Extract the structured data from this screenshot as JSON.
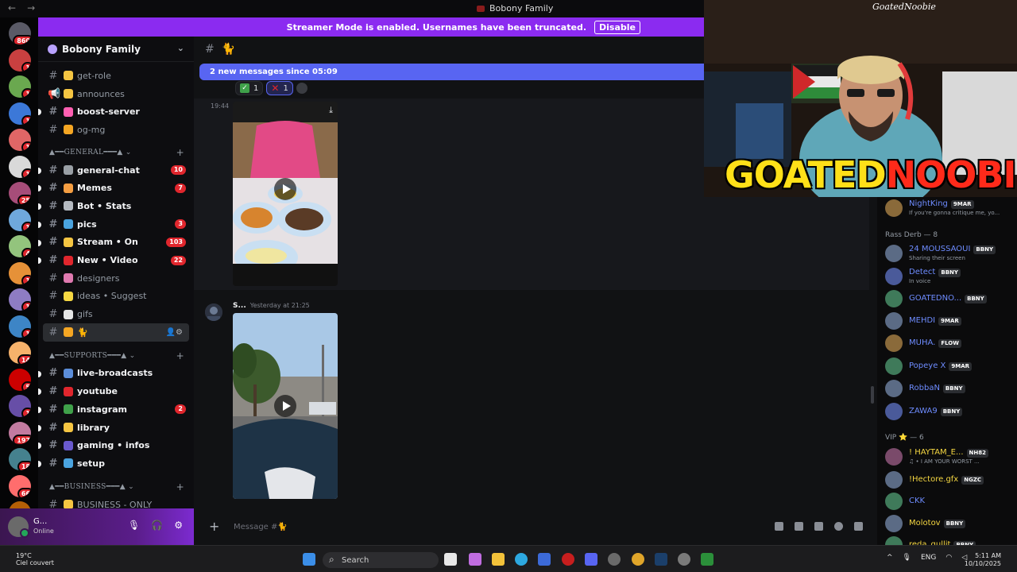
{
  "window": {
    "title": "Bobony Family"
  },
  "banner": {
    "text": "Streamer Mode is enabled. Usernames have been truncated.",
    "button": "Disable"
  },
  "guild": {
    "name": "Bobony Family"
  },
  "channels": [
    {
      "label": "get-role",
      "emoji_color": "#f5c542",
      "unread": false
    },
    {
      "label": "announces",
      "emoji_color": "#f5c542",
      "unread": false,
      "icon": "megaphone"
    },
    {
      "label": "boost-server",
      "emoji_color": "#ff5fb2",
      "unread": true
    },
    {
      "label": "og-mg",
      "emoji_color": "#f5a623",
      "unread": false
    }
  ],
  "general": {
    "title": "GENERAL",
    "channels": [
      {
        "label": "general-chat",
        "emoji_color": "#9aa0a6",
        "unread": true,
        "count": "10"
      },
      {
        "label": "Memes",
        "emoji_color": "#f59e42",
        "unread": true,
        "count": "7"
      },
      {
        "label": "Bot • Stats",
        "emoji_color": "#b5bac1",
        "unread": true
      },
      {
        "label": "pics",
        "emoji_color": "#4aa3df",
        "unread": true,
        "count": "3"
      },
      {
        "label": "Stream • On",
        "emoji_color": "#f5c542",
        "unread": true,
        "count": "103"
      },
      {
        "label": "New • Video",
        "emoji_color": "#e0262d",
        "unread": true,
        "count": "22"
      },
      {
        "label": "designers",
        "emoji_color": "#e07ab0",
        "unread": false
      },
      {
        "label": "ideas • Suggest",
        "emoji_color": "#f5d742",
        "unread": false
      },
      {
        "label": "gifs",
        "emoji_color": "#e5e5e5",
        "unread": false
      },
      {
        "label": "🐈",
        "emoji_color": "#f5a623",
        "unread": false,
        "active": true
      }
    ]
  },
  "supports": {
    "title": "SUPPORTS",
    "channels": [
      {
        "label": "live-broadcasts",
        "emoji_color": "#5b8dd9",
        "unread": true
      },
      {
        "label": "youtube",
        "emoji_color": "#e0262d",
        "unread": true
      },
      {
        "label": "instagram",
        "emoji_color": "#3fa14a",
        "unread": true,
        "count": "2"
      },
      {
        "label": "library",
        "emoji_color": "#f5c542",
        "unread": true
      },
      {
        "label": "gaming • infos",
        "emoji_color": "#6a5acd",
        "unread": true
      },
      {
        "label": "setup",
        "emoji_color": "#4aa3df",
        "unread": true
      }
    ]
  },
  "business": {
    "title": "BUSINESS",
    "channels": [
      {
        "label": "BUSINESS - ONLY",
        "emoji_color": "#f5c542",
        "unread": false
      }
    ]
  },
  "user": {
    "name": "G...",
    "status": "Online"
  },
  "rail_badges": [
    "860",
    "1",
    "1",
    "1",
    "1",
    "1",
    "25",
    "1",
    "4",
    "1",
    "1",
    "1",
    "14",
    "5",
    "1",
    "197",
    "18",
    "66",
    "NEW"
  ],
  "chat": {
    "channel": "🐈",
    "new_messages": "2 new messages since 05:09",
    "reactions": [
      {
        "count": "1"
      },
      {
        "count": "1"
      }
    ],
    "msg1_time": "19:44",
    "msg2_author": "S...",
    "msg2_time": "Yesterday at 21:25",
    "composer_placeholder": "Message #🐈"
  },
  "cam": {
    "handle": "GoatedNoobie",
    "logo_a": "GOATED",
    "logo_b": "NOOBIE"
  },
  "members": {
    "top": {
      "name": "NightKing",
      "tag": "9MAR",
      "status": "If you're gonna critique me, yo..."
    },
    "group1": "Rass Derb — 8",
    "list1": [
      {
        "name": "24 MOUSSAOUI",
        "tag": "BBNY",
        "status": "Sharing their screen",
        "color": "#6e8cff"
      },
      {
        "name": "Detect",
        "tag": "BBNY",
        "status": "In voice",
        "color": "#6e8cff"
      },
      {
        "name": "GOATEDNO...",
        "tag": "BBNY",
        "status": "",
        "color": "#6e8cff"
      },
      {
        "name": "MEHDI",
        "tag": "9MAR",
        "status": "",
        "color": "#6e8cff"
      },
      {
        "name": "MUHA.",
        "tag": "FLOW",
        "status": "",
        "color": "#6e8cff"
      },
      {
        "name": "Popeye X",
        "tag": "9MAR",
        "status": "",
        "color": "#6e8cff"
      },
      {
        "name": "RobbaN",
        "tag": "BBNY",
        "status": "",
        "color": "#6e8cff"
      },
      {
        "name": "ZAWA9",
        "tag": "BBNY",
        "status": "",
        "color": "#6e8cff"
      }
    ],
    "group2": "VIP ⭐ — 6",
    "list2": [
      {
        "name": "! HAYTAM_E...",
        "tag": "NH82",
        "status": "♫ • I AM YOUR WORST ...",
        "color": "#f5d742"
      },
      {
        "name": "!Hectore.gfx",
        "tag": "NGZC",
        "status": "",
        "color": "#f5d742"
      },
      {
        "name": "CKK",
        "tag": "",
        "status": "",
        "color": "#6e8cff"
      },
      {
        "name": "Molotov",
        "tag": "BBNY",
        "status": "",
        "color": "#f5d742"
      },
      {
        "name": "reda_gullit",
        "tag": "BBNY",
        "status": "",
        "color": "#f5d742"
      }
    ]
  },
  "taskbar": {
    "weather_temp": "19°C",
    "weather_desc": "Ciel couvert",
    "search": "Search",
    "lang": "ENG",
    "time": "5:11 AM",
    "date": "10/10/2025"
  }
}
